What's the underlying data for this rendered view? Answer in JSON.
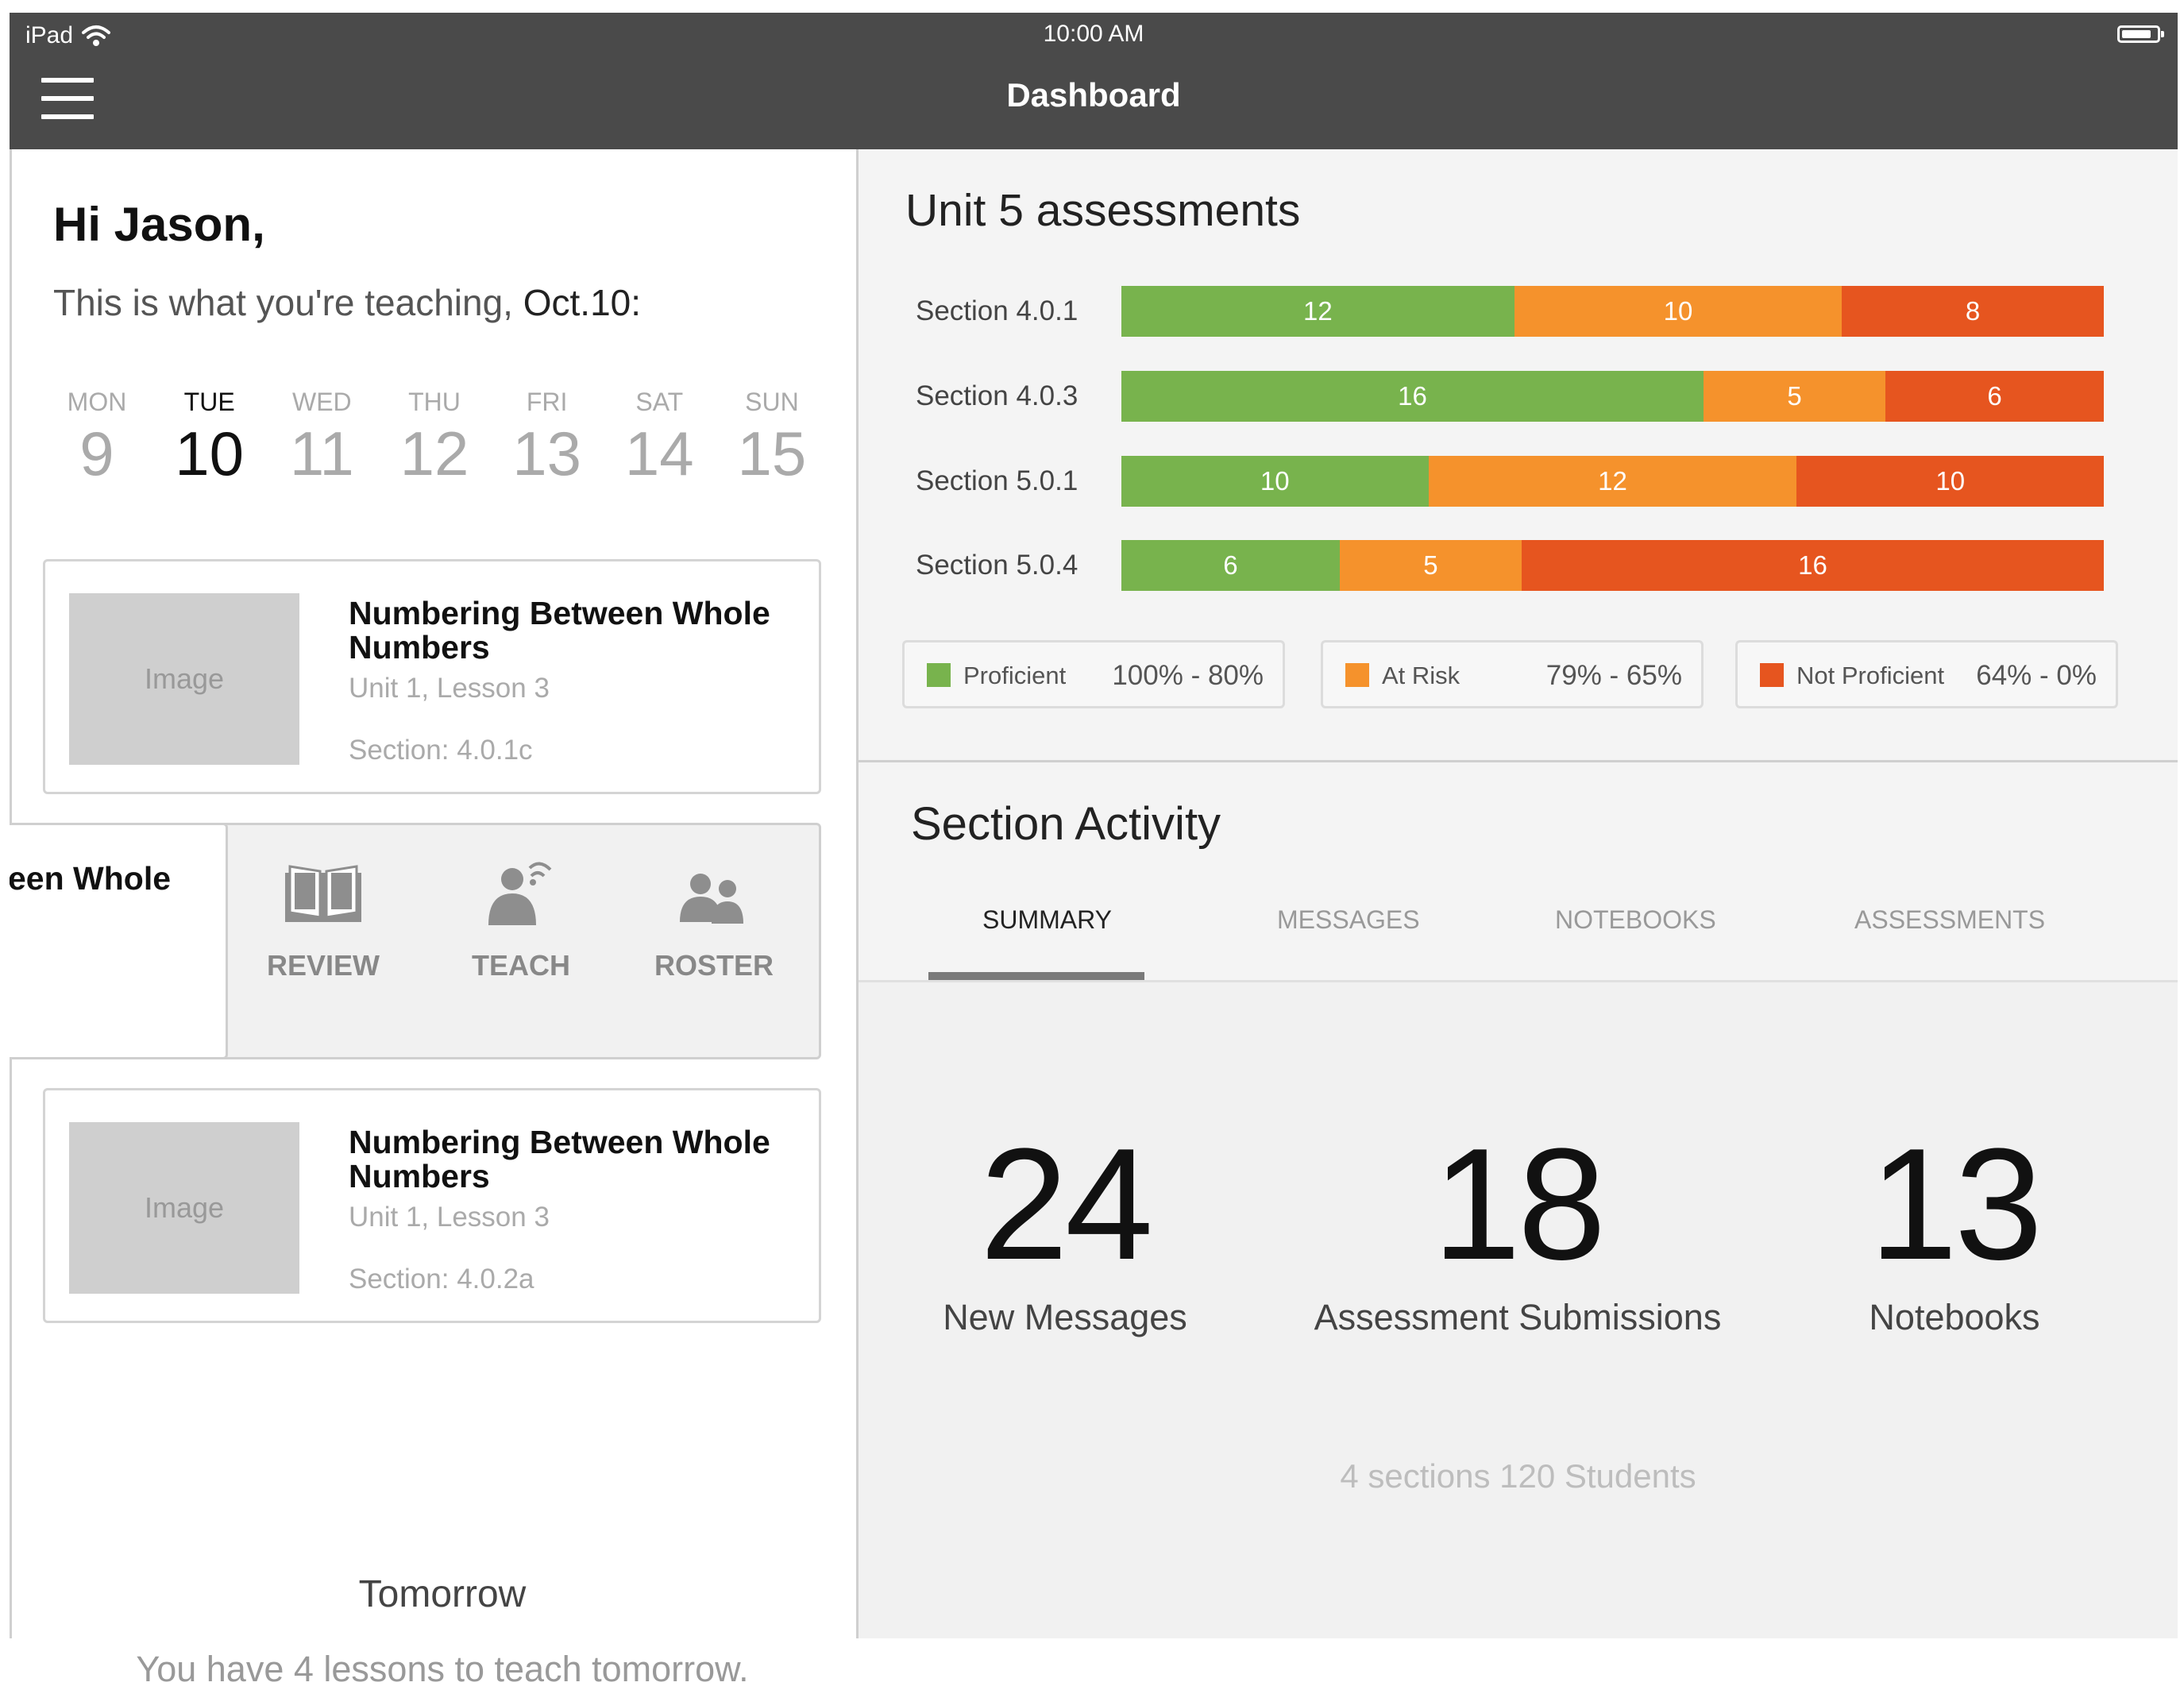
{
  "status": {
    "device": "iPad",
    "time": "10:00 AM"
  },
  "nav": {
    "title": "Dashboard"
  },
  "greeting": {
    "hello": "Hi Jason,",
    "subtitle_prefix": "This is what you're teaching, ",
    "subtitle_date": "Oct.10:"
  },
  "week": [
    {
      "name": "MON",
      "num": "9",
      "active": false
    },
    {
      "name": "TUE",
      "num": "10",
      "active": true
    },
    {
      "name": "WED",
      "num": "11",
      "active": false
    },
    {
      "name": "THU",
      "num": "12",
      "active": false
    },
    {
      "name": "FRI",
      "num": "13",
      "active": false
    },
    {
      "name": "SAT",
      "num": "14",
      "active": false
    },
    {
      "name": "SUN",
      "num": "15",
      "active": false
    }
  ],
  "lessons": [
    {
      "image": "Image",
      "title": "Numbering Between Whole Numbers",
      "unit": "Unit 1, Lesson 3",
      "section": "Section: 4.0.1c"
    },
    {
      "title_fragment": "een Whole"
    },
    {
      "image": "Image",
      "title": "Numbering Between Whole Numbers",
      "unit": "Unit 1, Lesson 3",
      "section": "Section: 4.0.2a"
    }
  ],
  "actions": {
    "review": "REVIEW",
    "teach": "TEACH",
    "roster": "ROSTER"
  },
  "tomorrow": {
    "title": "Tomorrow",
    "text": "You have 4 lessons to teach tomorrow."
  },
  "assessments": {
    "title": "Unit 5 assessments",
    "colors": {
      "proficient": "#78b34d",
      "at_risk": "#f5922c",
      "not_proficient": "#e6551f"
    },
    "rows": [
      {
        "label": "Section 4.0.1",
        "values": [
          12,
          10,
          8
        ]
      },
      {
        "label": "Section 4.0.3",
        "values": [
          16,
          5,
          6
        ]
      },
      {
        "label": "Section 5.0.1",
        "values": [
          10,
          12,
          10
        ]
      },
      {
        "label": "Section 5.0.4",
        "values": [
          6,
          5,
          16
        ]
      }
    ],
    "legend": [
      {
        "name": "Proficient",
        "range": "100% - 80%"
      },
      {
        "name": "At Risk",
        "range": "79% - 65%"
      },
      {
        "name": "Not Proficient",
        "range": "64% - 0%"
      }
    ]
  },
  "activity": {
    "title": "Section Activity",
    "tabs": [
      "SUMMARY",
      "MESSAGES",
      "NOTEBOOKS",
      "ASSESSMENTS"
    ],
    "active_tab": "SUMMARY",
    "stats": [
      {
        "value": "24",
        "label": "New Messages"
      },
      {
        "value": "18",
        "label": "Assessment Submissions"
      },
      {
        "value": "13",
        "label": "Notebooks"
      }
    ],
    "footer": "4 sections 120 Students"
  }
}
